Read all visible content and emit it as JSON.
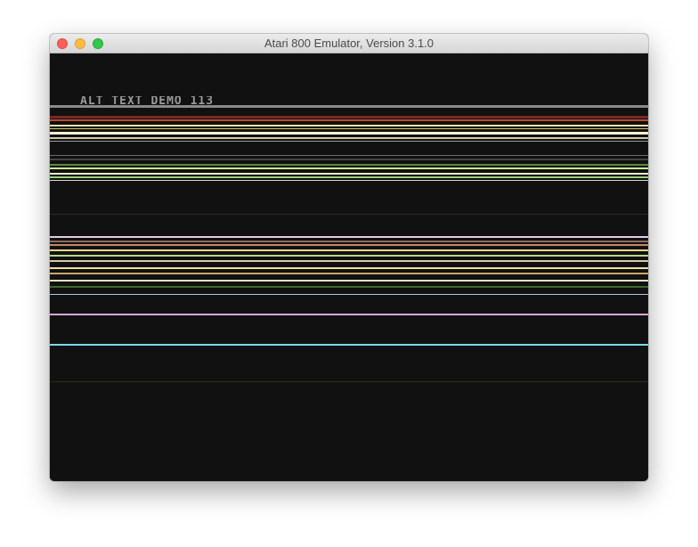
{
  "window": {
    "title": "Atari 800 Emulator, Version 3.1.0"
  },
  "emulator_screen": {
    "text_line": "ALT TEXT DEMO 113 ",
    "background_color": "#111111"
  },
  "scanlines": [
    {
      "color": "#8a8a8a"
    },
    {
      "color": "#7a2a1e"
    },
    {
      "color": "#b84b3a"
    },
    {
      "color": "#e8e2a4"
    },
    {
      "color": "#d9c26a"
    },
    {
      "color": "#f2f0d2"
    },
    {
      "color": "#cfc9b0"
    },
    {
      "color": "#9a9a9a"
    },
    {
      "color": "#6a6a6a"
    },
    {
      "color": "#444444"
    },
    {
      "color": "#5a8a3a"
    },
    {
      "color": "#c9e89a"
    },
    {
      "color": "#e8f2c8"
    },
    {
      "color": "#9ad07a"
    },
    {
      "color": "#d8d8d8"
    },
    {
      "color": "#2a2a2a"
    },
    {
      "color": "#e8c8e8"
    },
    {
      "color": "#8a6a5a"
    },
    {
      "color": "#c28a6a"
    },
    {
      "color": "#e8d28a"
    },
    {
      "color": "#b8d88a"
    },
    {
      "color": "#d8c8a8"
    },
    {
      "color": "#f0e0a0"
    },
    {
      "color": "#c8a868"
    },
    {
      "color": "#e8e0c0"
    },
    {
      "color": "#3a6a2a"
    },
    {
      "color": "#a8c8e8"
    },
    {
      "color": "#d8a8d8"
    },
    {
      "color": "#7ad8f0"
    },
    {
      "color": "#3a2a10"
    }
  ]
}
